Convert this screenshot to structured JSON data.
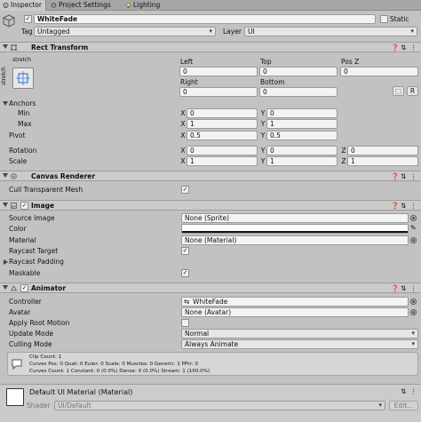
{
  "tabs": [
    {
      "label": "Inspector",
      "icon": "info-icon"
    },
    {
      "label": "Project Settings",
      "icon": "gear-icon"
    },
    {
      "label": "Lighting",
      "icon": "lightbulb-icon"
    }
  ],
  "object": {
    "name": "WhiteFade",
    "static_label": "Static",
    "tag_label": "Tag",
    "tag_value": "Untagged",
    "layer_label": "Layer",
    "layer_value": "UI"
  },
  "rect_transform": {
    "title": "Rect Transform",
    "anchor_preset_top": "stretch",
    "anchor_preset_side": "stretch",
    "left_label": "Left",
    "left_value": "0",
    "top_label": "Top",
    "top_value": "0",
    "posz_label": "Pos Z",
    "posz_value": "0",
    "right_label": "Right",
    "right_value": "0",
    "bottom_label": "Bottom",
    "bottom_value": "0",
    "anchors_label": "Anchors",
    "min_label": "Min",
    "min_x": "0",
    "min_y": "0",
    "max_label": "Max",
    "max_x": "1",
    "max_y": "1",
    "pivot_label": "Pivot",
    "pivot_x": "0.5",
    "pivot_y": "0.5",
    "rotation_label": "Rotation",
    "rot_x": "0",
    "rot_y": "0",
    "rot_z": "0",
    "scale_label": "Scale",
    "scale_x": "1",
    "scale_y": "1",
    "scale_z": "1",
    "axis_x": "X",
    "axis_y": "Y",
    "axis_z": "Z",
    "blueprint_button": "⬚",
    "raw_button": "R"
  },
  "canvas_renderer": {
    "title": "Canvas Renderer",
    "cull_label": "Cull Transparent Mesh",
    "cull_checked": "✓"
  },
  "image": {
    "title": "Image",
    "source_label": "Source Image",
    "source_value": "None (Sprite)",
    "color_label": "Color",
    "material_label": "Material",
    "material_value": "None (Material)",
    "raycast_label": "Raycast Target",
    "raycast_checked": "✓",
    "padding_label": "Raycast Padding",
    "maskable_label": "Maskable",
    "maskable_checked": "✓"
  },
  "animator": {
    "title": "Animator",
    "controller_label": "Controller",
    "controller_value": "WhiteFade",
    "avatar_label": "Avatar",
    "avatar_value": "None (Avatar)",
    "root_motion_label": "Apply Root Motion",
    "update_label": "Update Mode",
    "update_value": "Normal",
    "culling_label": "Culling Mode",
    "culling_value": "Always Animate",
    "info_line1": "Clip Count: 1",
    "info_line2": "Curves Pos: 0 Quat: 0 Euler: 0 Scale: 0 Muscles: 0 Generic: 1 PPtr: 0",
    "info_line3": "Curves Count: 1 Constant: 0 (0.0%) Dense: 0 (0.0%) Stream: 1 (100.0%)"
  },
  "material": {
    "title": "Default UI Material (Material)",
    "shader_label": "Shader",
    "shader_value": "UI/Default",
    "edit_label": "Edit..."
  },
  "colors": {
    "header_bg": "#cbcbcb",
    "panel_bg": "#c2c2c2",
    "field_bg": "#f3f3f3",
    "accent": "#3c7fd8"
  }
}
